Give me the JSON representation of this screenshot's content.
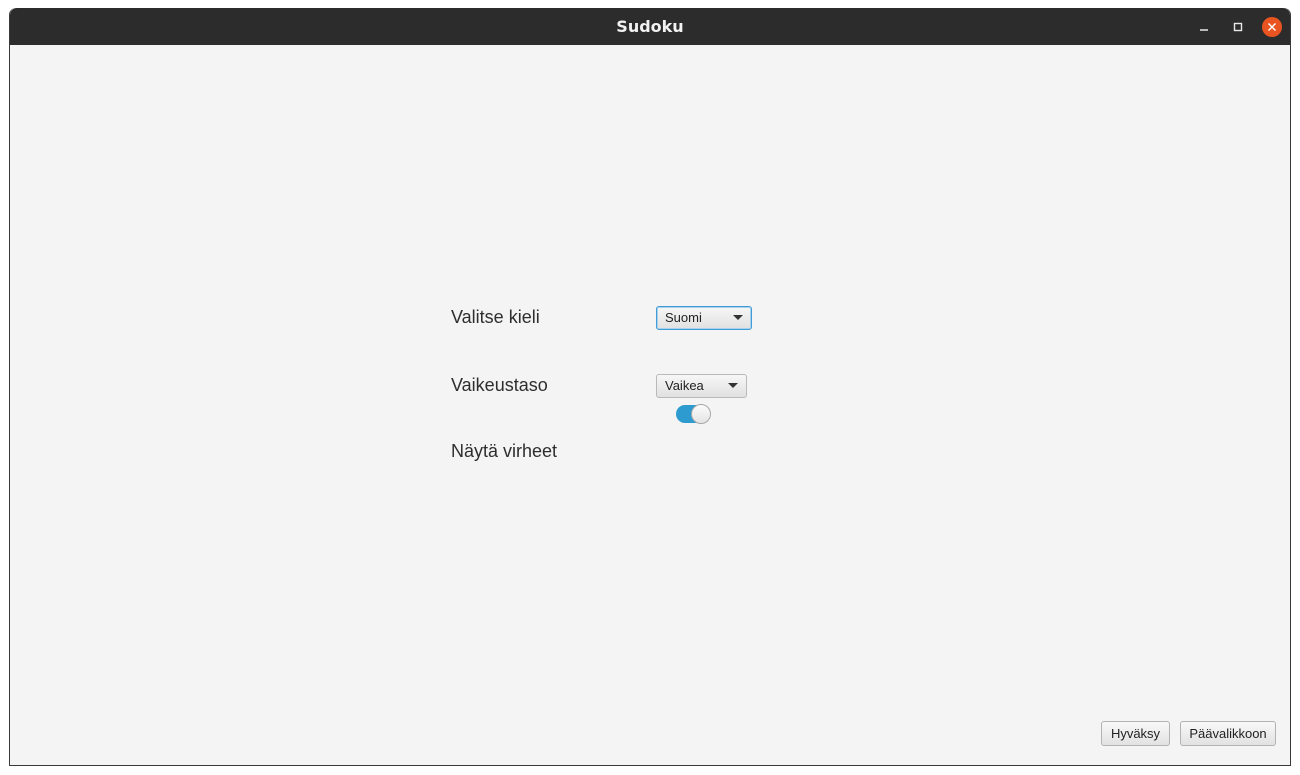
{
  "window": {
    "title": "Sudoku",
    "controls": {
      "minimize_icon": "minimize-icon",
      "maximize_icon": "maximize-icon",
      "close_icon": "close-icon",
      "close_color": "#e95420"
    }
  },
  "settings": {
    "language": {
      "label": "Valitse kieli",
      "selected": "Suomi"
    },
    "difficulty": {
      "label": "Vaikeustaso",
      "selected": "Vaikea"
    },
    "show_errors": {
      "label": "Näytä virheet",
      "enabled": true
    }
  },
  "footer": {
    "accept_label": "Hyväksy",
    "main_menu_label": "Päävalikkoon"
  },
  "colors": {
    "titlebar": "#2c2c2c",
    "background": "#f4f4f4",
    "accent": "#2d9bd0"
  }
}
